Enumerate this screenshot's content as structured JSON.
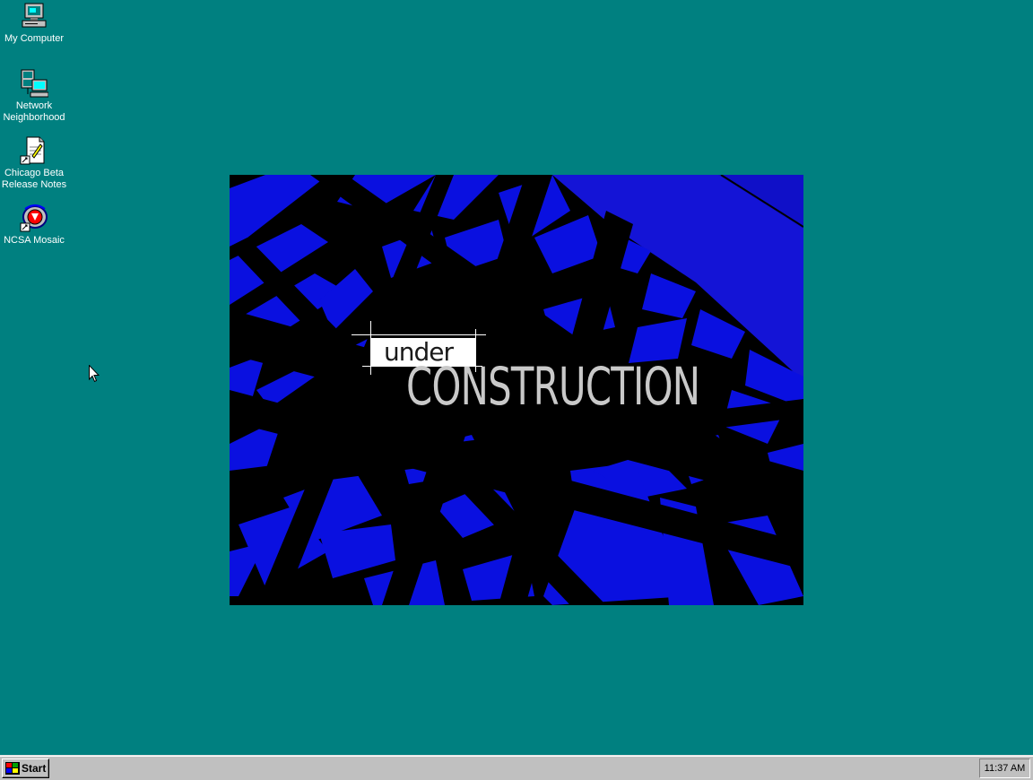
{
  "desktop": {
    "background": "#008080",
    "icons": [
      {
        "label": "My Computer",
        "icon": "my-computer-icon"
      },
      {
        "label": "Network\nNeighborhood",
        "icon": "network-neighborhood-icon"
      },
      {
        "label": "Chicago Beta\nRelease Notes",
        "icon": "release-notes-icon"
      },
      {
        "label": "NCSA Mosaic",
        "icon": "ncsa-mosaic-icon"
      }
    ]
  },
  "splash": {
    "word_small": "under",
    "word_large": "CONSTRUCTION",
    "colors": {
      "background": "#000000",
      "structure": "#0a10e0",
      "sky": "#1a1ad8",
      "text": "#c9c9c9"
    }
  },
  "taskbar": {
    "start_label": "Start",
    "clock": "11:37 AM"
  }
}
